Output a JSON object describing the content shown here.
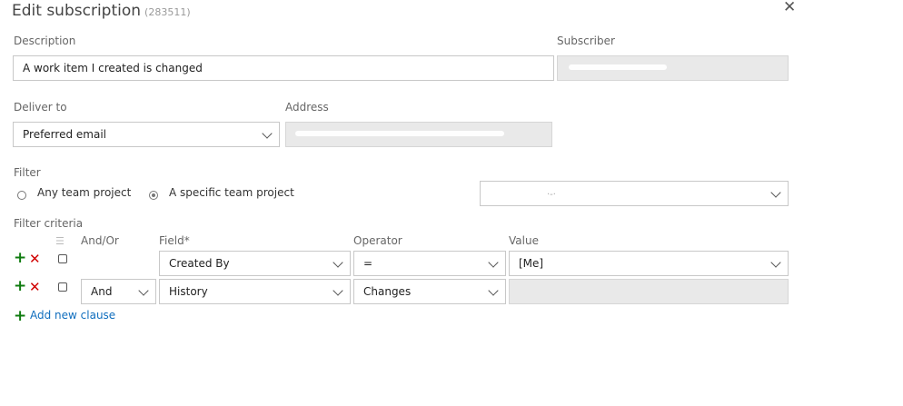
{
  "dialog": {
    "title": "Edit subscription",
    "id_text": "(283511)"
  },
  "description": {
    "label": "Description",
    "value": "A work item I created is changed"
  },
  "subscriber": {
    "label": "Subscriber"
  },
  "deliver_to": {
    "label": "Deliver to",
    "selected": "Preferred email"
  },
  "address": {
    "label": "Address"
  },
  "filter": {
    "label": "Filter",
    "options": [
      {
        "label": "Any team project",
        "checked": false
      },
      {
        "label": "A specific team project",
        "checked": true
      }
    ]
  },
  "criteria": {
    "label": "Filter criteria",
    "columns": {
      "andor": "And/Or",
      "field": "Field*",
      "operator": "Operator",
      "value": "Value"
    },
    "rows": [
      {
        "andor": "",
        "field": "Created By",
        "operator": "=",
        "value": "[Me]"
      },
      {
        "andor": "And",
        "field": "History",
        "operator": "Changes",
        "value": ""
      }
    ],
    "add_clause": "Add new clause"
  },
  "icons": {
    "close": "close-icon",
    "add": "plus-icon",
    "remove": "x-icon",
    "dropdown": "chevron-down-icon",
    "group": "group-clauses-icon"
  },
  "colors": {
    "add": "#107c10",
    "remove": "#d00000",
    "link": "#106ebe",
    "disabled_bg": "#e9e9e9"
  }
}
